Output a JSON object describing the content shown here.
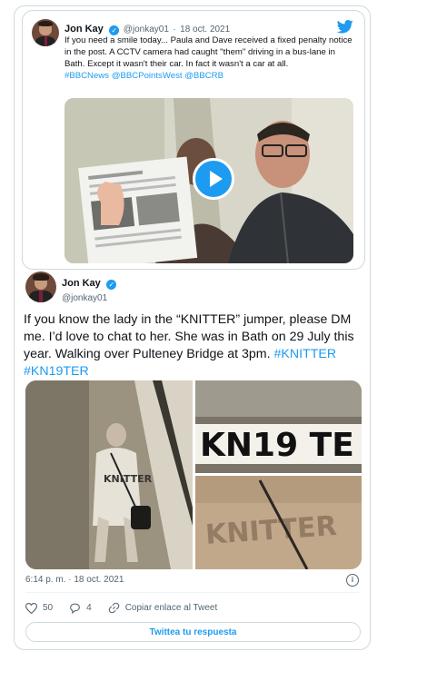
{
  "quoted_tweet": {
    "author_name": "Jon Kay",
    "handle": "@jonkay01",
    "separator": "·",
    "date": "18 oct. 2021",
    "text": "If you need a smile today... Paula and Dave received a fixed penalty notice in the post. A CCTV camera had caught \"them\" driving in a bus-lane in Bath. Except it wasn't their car. In fact it wasn't a car at all.",
    "hashtags": "#BBCNews @BBCPointsWest @BBCRB"
  },
  "main_tweet": {
    "author_name": "Jon Kay",
    "handle": "@jonkay01",
    "text": "If you know the lady in the “KNITTER” jumper, please DM me. I’d love to chat to her. She was in Bath on 29 July this year. Walking over Pulteney Bridge at 3pm.",
    "tag1": "#KNITTER",
    "tag2": "#KN19TER",
    "plate_text": "KN19 TE",
    "jumper_text": "KNITTER",
    "timestamp": "6:14 p. m. · 18 oct. 2021",
    "likes": "50",
    "replies": "4",
    "copy_link": "Copiar enlace al Tweet",
    "reply_button": "Twittea tu respuesta"
  },
  "colors": {
    "accent": "#1d9bf0",
    "text": "#0f1419",
    "muted": "#536471",
    "border": "#cfd9de"
  },
  "icons": [
    "twitter-bird-icon",
    "verified-badge-icon",
    "play-icon",
    "info-icon",
    "heart-icon",
    "comment-icon",
    "link-icon"
  ]
}
